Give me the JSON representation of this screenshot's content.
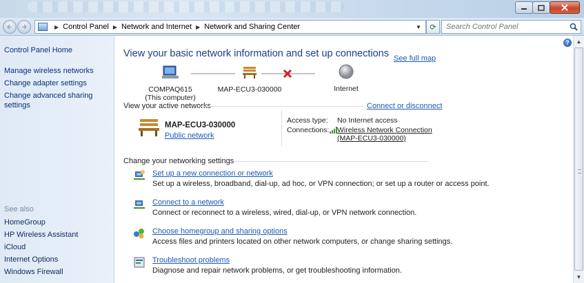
{
  "address": {
    "breadcrumbs": [
      "Control Panel",
      "Network and Internet",
      "Network and Sharing Center"
    ],
    "search_placeholder": "Search Control Panel"
  },
  "sidebar": {
    "home": "Control Panel Home",
    "tasks": [
      "Manage wireless networks",
      "Change adapter settings",
      "Change advanced sharing settings"
    ],
    "see_also_header": "See also",
    "see_also": [
      "HomeGroup",
      "HP Wireless Assistant",
      "iCloud",
      "Internet Options",
      "Windows Firewall"
    ]
  },
  "main": {
    "heading": "View your basic network information and set up connections",
    "see_full_map": "See full map",
    "map": {
      "computer": "COMPAQ615",
      "computer_note": "(This computer)",
      "network": "MAP-ECU3-030000",
      "internet": "Internet"
    },
    "active_networks": {
      "header": "View your active networks",
      "action": "Connect or disconnect",
      "name": "MAP-ECU3-030000",
      "type": "Public network",
      "access_type_label": "Access type:",
      "access_type_value": "No Internet access",
      "connections_label": "Connections:",
      "connection_value_1": "Wireless Network Connection",
      "connection_value_2": "(MAP-ECU3-030000)"
    },
    "change_settings": {
      "header": "Change your networking settings",
      "tasks": [
        {
          "title": "Set up a new connection or network",
          "desc": "Set up a wireless, broadband, dial-up, ad hoc, or VPN connection; or set up a router or access point."
        },
        {
          "title": "Connect to a network",
          "desc": "Connect or reconnect to a wireless, wired, dial-up, or VPN network connection."
        },
        {
          "title": "Choose homegroup and sharing options",
          "desc": "Access files and printers located on other network computers, or change sharing settings."
        },
        {
          "title": "Troubleshoot problems",
          "desc": "Diagnose and repair network problems, or get troubleshooting information."
        }
      ]
    }
  },
  "colors": {
    "link": "#1a59b5",
    "heading": "#1b3f80",
    "sidebar_bg": "#e4eef8",
    "error_x": "#d21f1f"
  }
}
